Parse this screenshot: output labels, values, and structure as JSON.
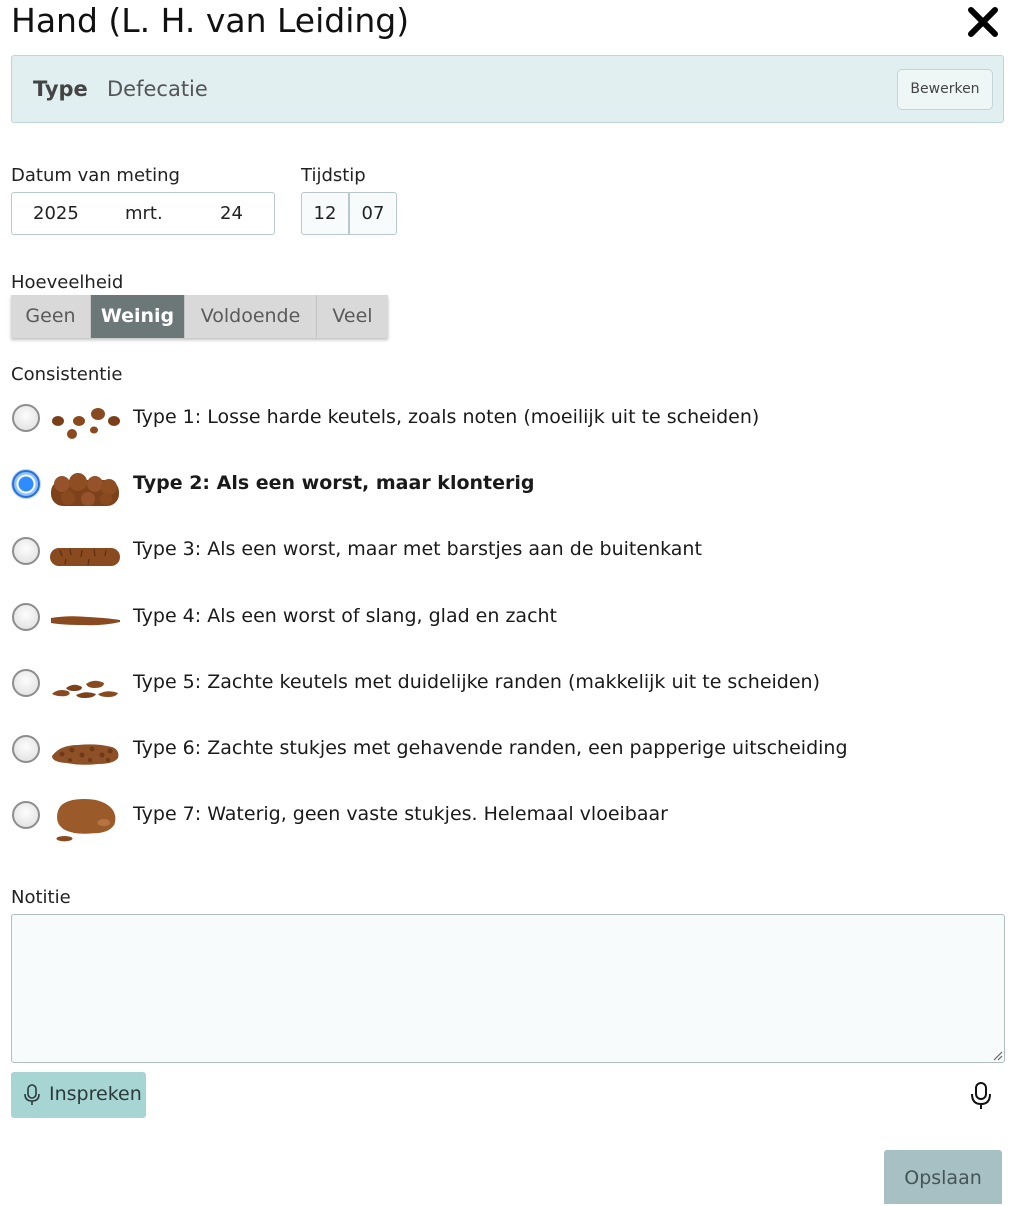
{
  "title": "Hand (L. H. van Leiding)",
  "type_box": {
    "label": "Type",
    "value": "Defecatie",
    "edit_label": "Bewerken"
  },
  "date": {
    "label": "Datum van meting",
    "year": "2025",
    "month": "mrt.",
    "day": "24"
  },
  "time": {
    "label": "Tijdstip",
    "hour": "12",
    "minute": "07"
  },
  "amount": {
    "label": "Hoeveelheid",
    "options": [
      "Geen",
      "Weinig",
      "Voldoende",
      "Veel"
    ],
    "selected": "Weinig"
  },
  "consistency": {
    "label": "Consistentie",
    "selected_index": 1,
    "options": [
      {
        "label": "Type 1: Losse harde keutels, zoals noten (moeilijk uit te scheiden)"
      },
      {
        "label": "Type 2: Als een worst, maar klonterig"
      },
      {
        "label": "Type 3: Als een worst, maar met barstjes aan de buitenkant"
      },
      {
        "label": "Type 4: Als een worst of slang, glad en zacht"
      },
      {
        "label": "Type 5: Zachte keutels met duidelijke randen (makkelijk uit te scheiden)"
      },
      {
        "label": "Type 6: Zachte stukjes met gehavende randen, een papperige uitscheiding"
      },
      {
        "label": "Type 7: Waterig, geen vaste stukjes. Helemaal vloeibaar"
      }
    ]
  },
  "notes": {
    "label": "Notitie",
    "value": "",
    "speak_label": "Inspreken"
  },
  "save_label": "Opslaan",
  "colors": {
    "accent": "#2f8cff",
    "type_box_bg": "#e1eff0",
    "segment_active": "#6c7778",
    "speak_button": "#a6d5d3",
    "save_button": "#a7c0c3"
  },
  "icons": [
    "close-icon",
    "microphone-icon",
    "stool-type-icon"
  ]
}
